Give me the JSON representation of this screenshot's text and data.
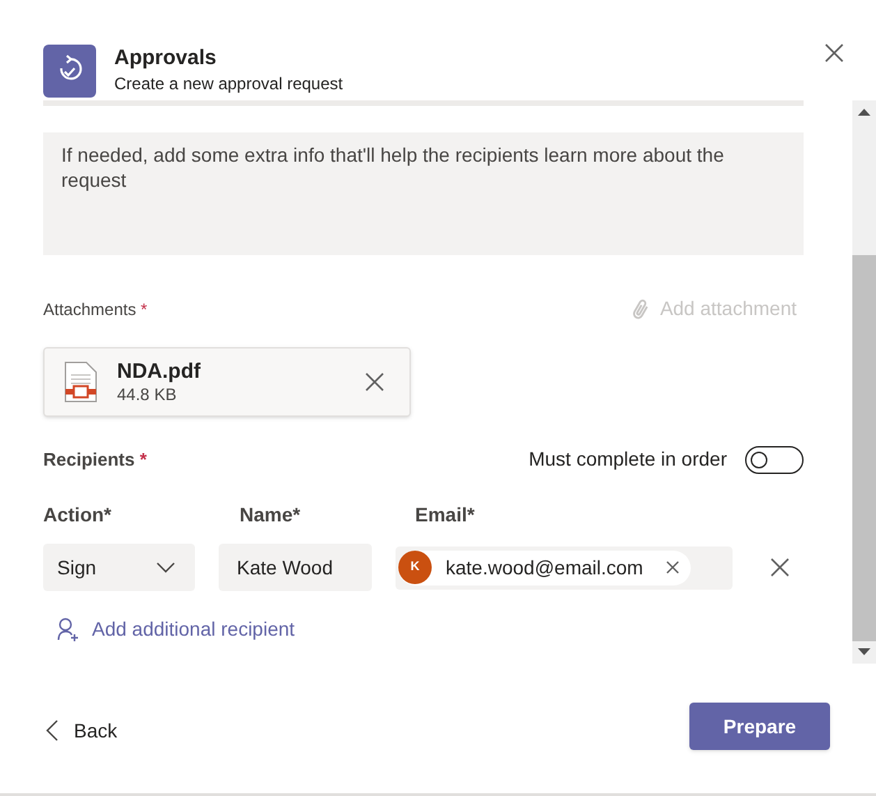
{
  "header": {
    "title": "Approvals",
    "subtitle": "Create a new approval request"
  },
  "details": {
    "placeholder": "If needed, add some extra info that'll help the recipients learn more about the request"
  },
  "attachments": {
    "label": "Attachments",
    "required_mark": "*",
    "add_button": "Add attachment",
    "add_disabled": true,
    "files": [
      {
        "name": "NDA.pdf",
        "size": "44.8 KB"
      }
    ]
  },
  "recipients": {
    "label": "Recipients",
    "required_mark": "*",
    "order_label": "Must complete in order",
    "order_on": false,
    "columns": [
      "Action*",
      "Name*",
      "Email*"
    ],
    "rows": [
      {
        "action": "Sign",
        "name": "Kate Wood",
        "initial": "K",
        "email": "kate.wood@email.com"
      }
    ],
    "add_link": "Add additional recipient"
  },
  "footer": {
    "back": "Back",
    "prepare": "Prepare"
  }
}
